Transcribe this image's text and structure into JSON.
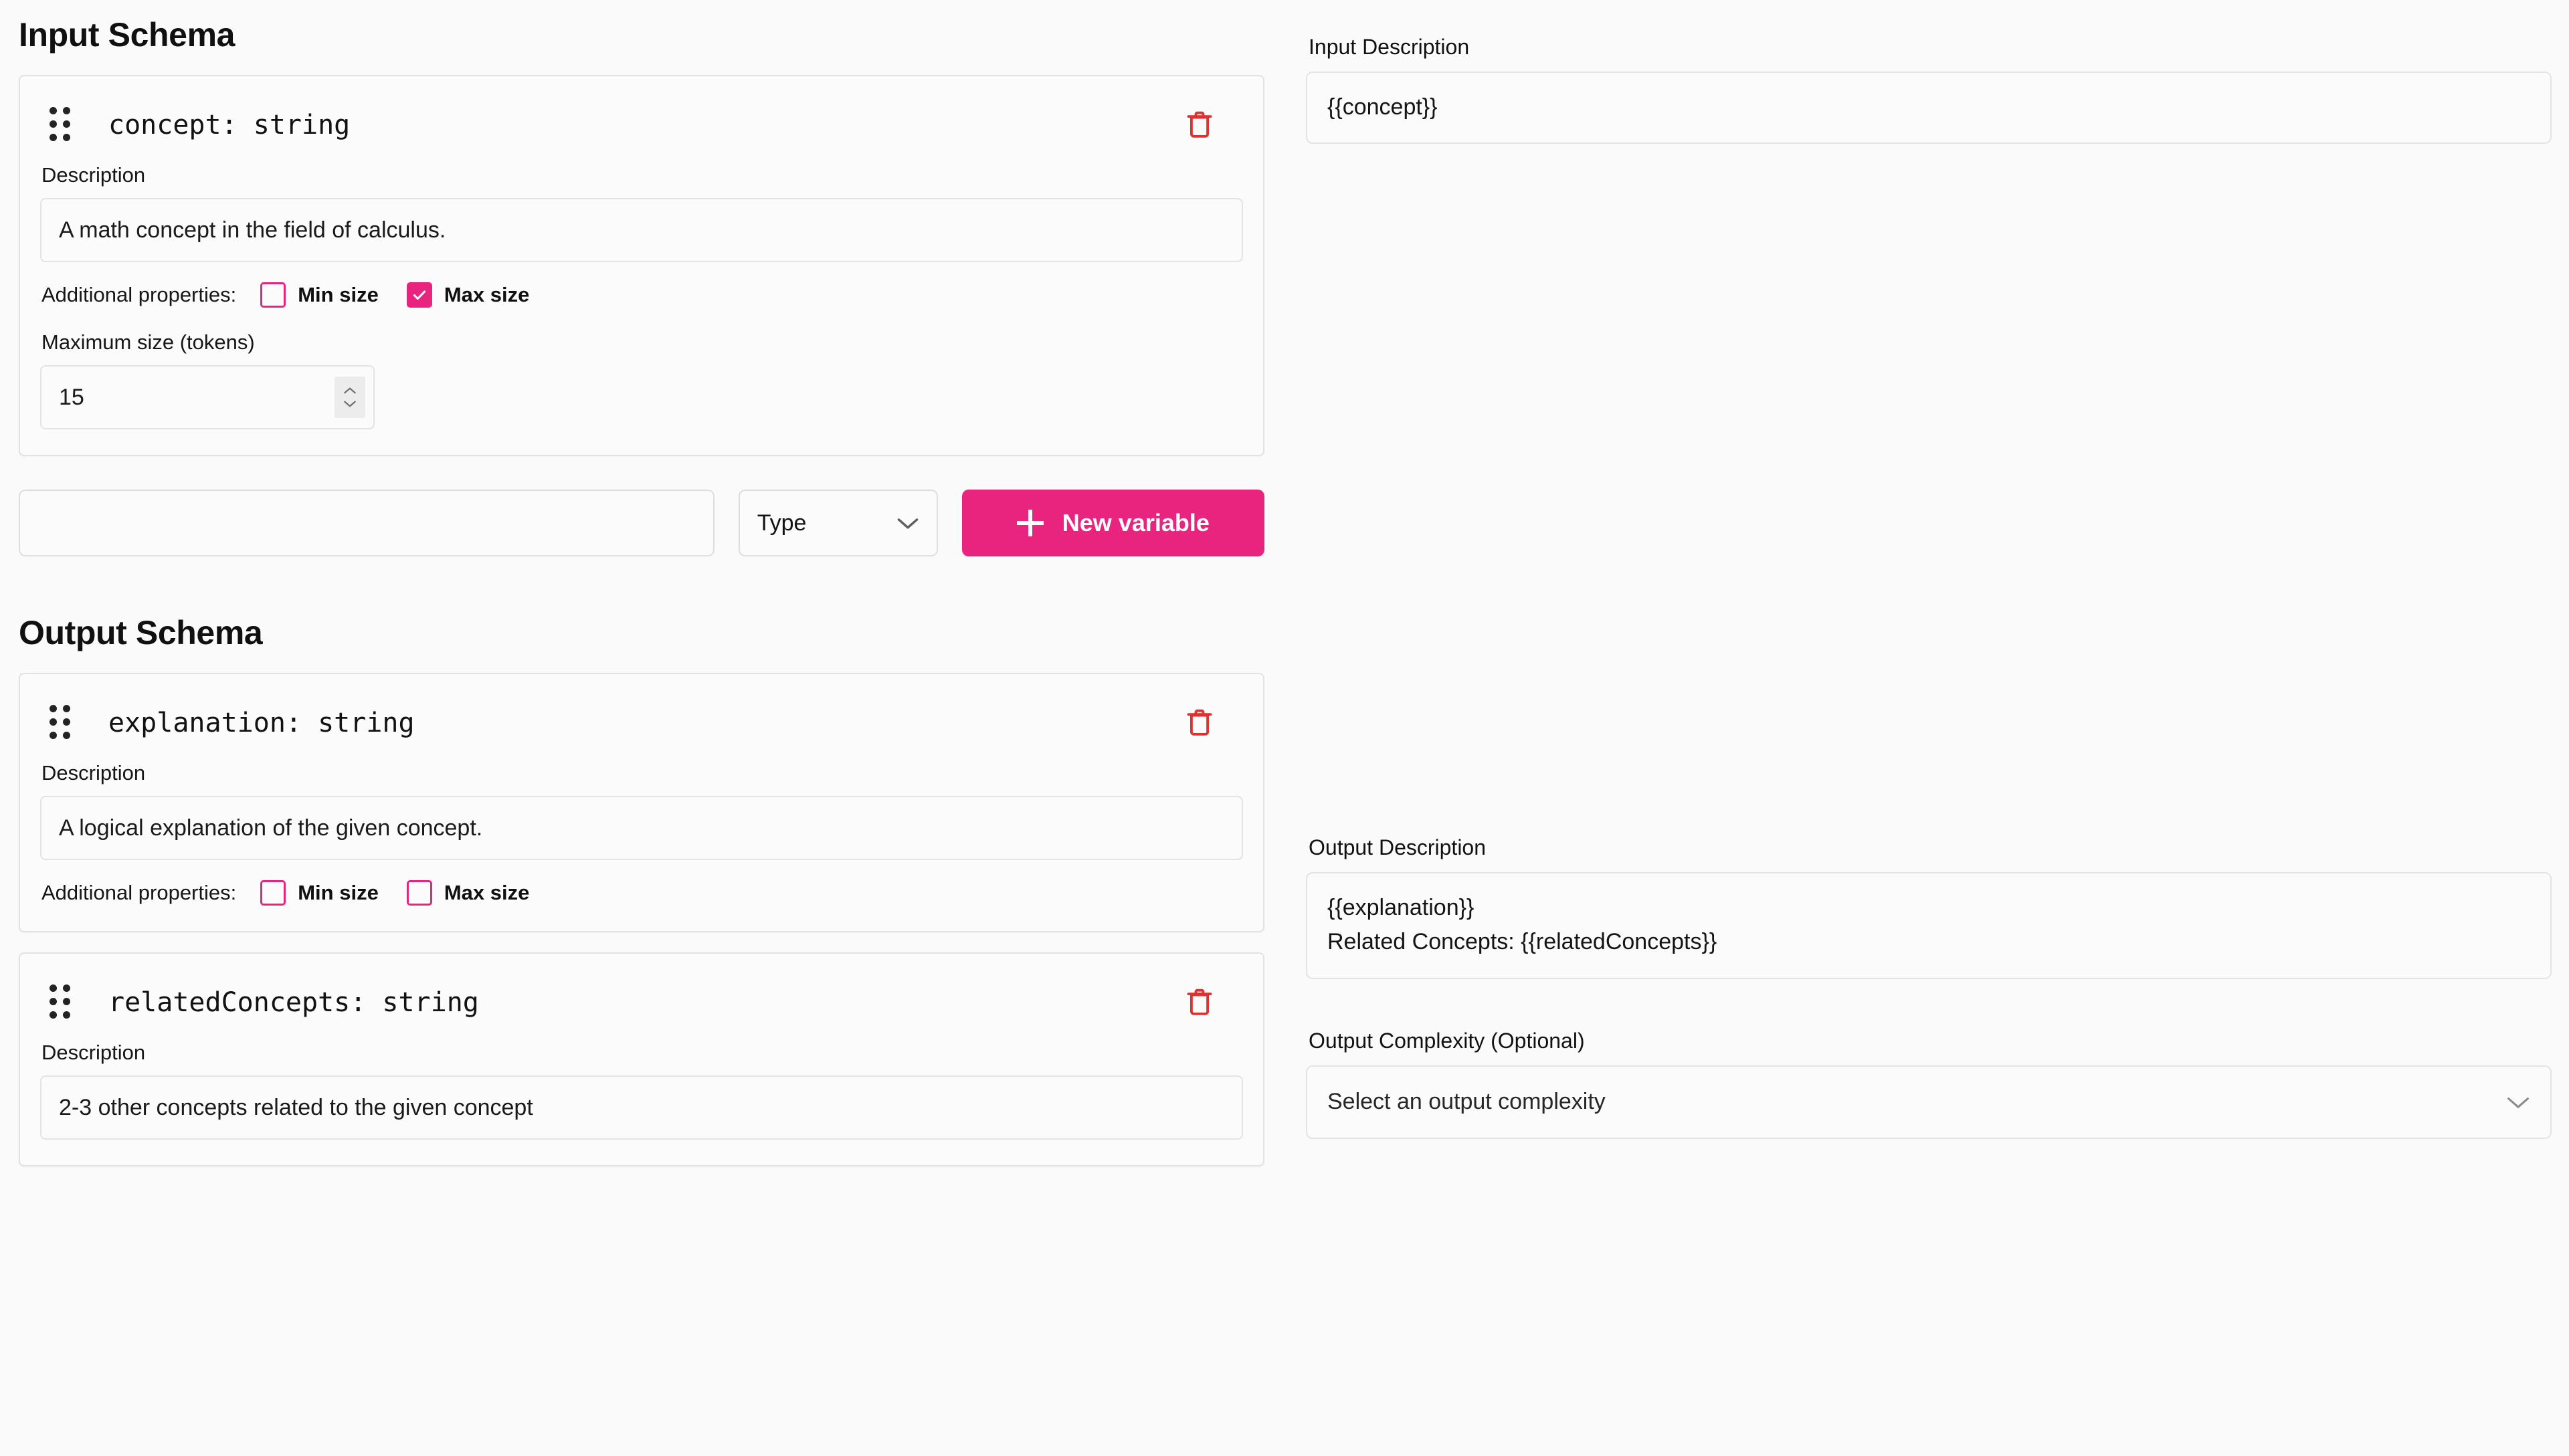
{
  "accent": {
    "pink": "#e8247e",
    "red": "#e03131",
    "border": "#e3e3e3",
    "page_bg": "#fafafa"
  },
  "input_schema": {
    "title": "Input Schema",
    "fields": [
      {
        "signature": "concept: string",
        "description_label": "Description",
        "description_value": "A math concept in the field of calculus.",
        "additional_label": "Additional properties:",
        "min_size_label": "Min size",
        "min_size_checked": false,
        "max_size_label": "Max size",
        "max_size_checked": true,
        "max_size_field_label": "Maximum size (tokens)",
        "max_size_value": "15",
        "delete_icon": "trash-icon",
        "drag_icon": "drag-handle-icon"
      }
    ],
    "new_variable_row": {
      "name_placeholder": "",
      "name_value": "",
      "type_label": "Type",
      "type_chevron": "chevron-down-icon",
      "button_label": "New variable",
      "button_icon": "plus-icon"
    }
  },
  "output_schema": {
    "title": "Output Schema",
    "fields": [
      {
        "signature": "explanation: string",
        "description_label": "Description",
        "description_value": "A logical explanation of the given concept.",
        "additional_label": "Additional properties:",
        "min_size_label": "Min size",
        "min_size_checked": false,
        "max_size_label": "Max size",
        "max_size_checked": false,
        "delete_icon": "trash-icon",
        "drag_icon": "drag-handle-icon"
      },
      {
        "signature": "relatedConcepts: string",
        "description_label": "Description",
        "description_value": "2-3 other concepts related to the given concept",
        "delete_icon": "trash-icon",
        "drag_icon": "drag-handle-icon"
      }
    ]
  },
  "sidebar_right": {
    "input_description_label": "Input Description",
    "input_description_value": "{{concept}}",
    "output_description_label": "Output Description",
    "output_description_value": "{{explanation}}\nRelated Concepts: {{relatedConcepts}}",
    "output_complexity_label": "Output Complexity (Optional)",
    "output_complexity_placeholder": "Select an output complexity",
    "output_complexity_chevron": "chevron-down-icon"
  }
}
